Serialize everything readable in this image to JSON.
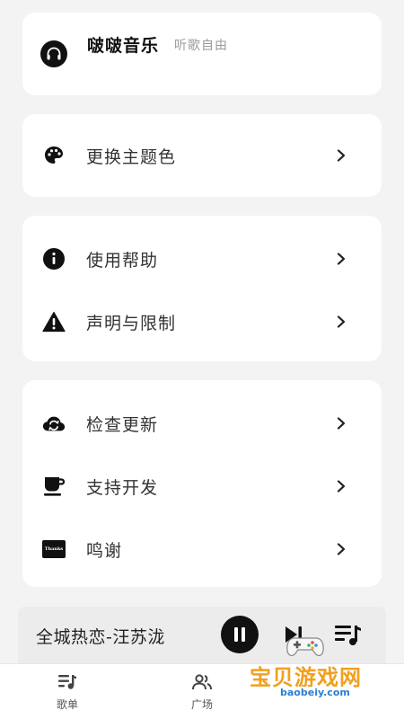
{
  "header": {
    "app_name": "啵啵音乐",
    "slogan": "听歌自由",
    "logo_icon": "headphones-icon"
  },
  "menu": {
    "theme": {
      "label": "更换主题色",
      "icon": "palette-icon"
    },
    "help": {
      "label": "使用帮助",
      "icon": "info-icon"
    },
    "disclaimer": {
      "label": "声明与限制",
      "icon": "warning-icon"
    },
    "update": {
      "label": "检查更新",
      "icon": "cloud-sync-icon"
    },
    "support": {
      "label": "支持开发",
      "icon": "coffee-cup-icon"
    },
    "thanks": {
      "label": "鸣谢",
      "icon": "thanks-icon",
      "badge_text": "Thanks"
    }
  },
  "player": {
    "song": "全城热恋-汪苏泷"
  },
  "tabs": [
    {
      "label": "歌单",
      "icon": "playlist-icon"
    },
    {
      "label": "广场",
      "icon": "users-icon"
    }
  ],
  "watermark": {
    "text": "宝贝游戏网",
    "url": "baobeiy.com"
  },
  "colors": {
    "background": "#f3f3f3",
    "card": "#ffffff",
    "accent": "#111111"
  }
}
